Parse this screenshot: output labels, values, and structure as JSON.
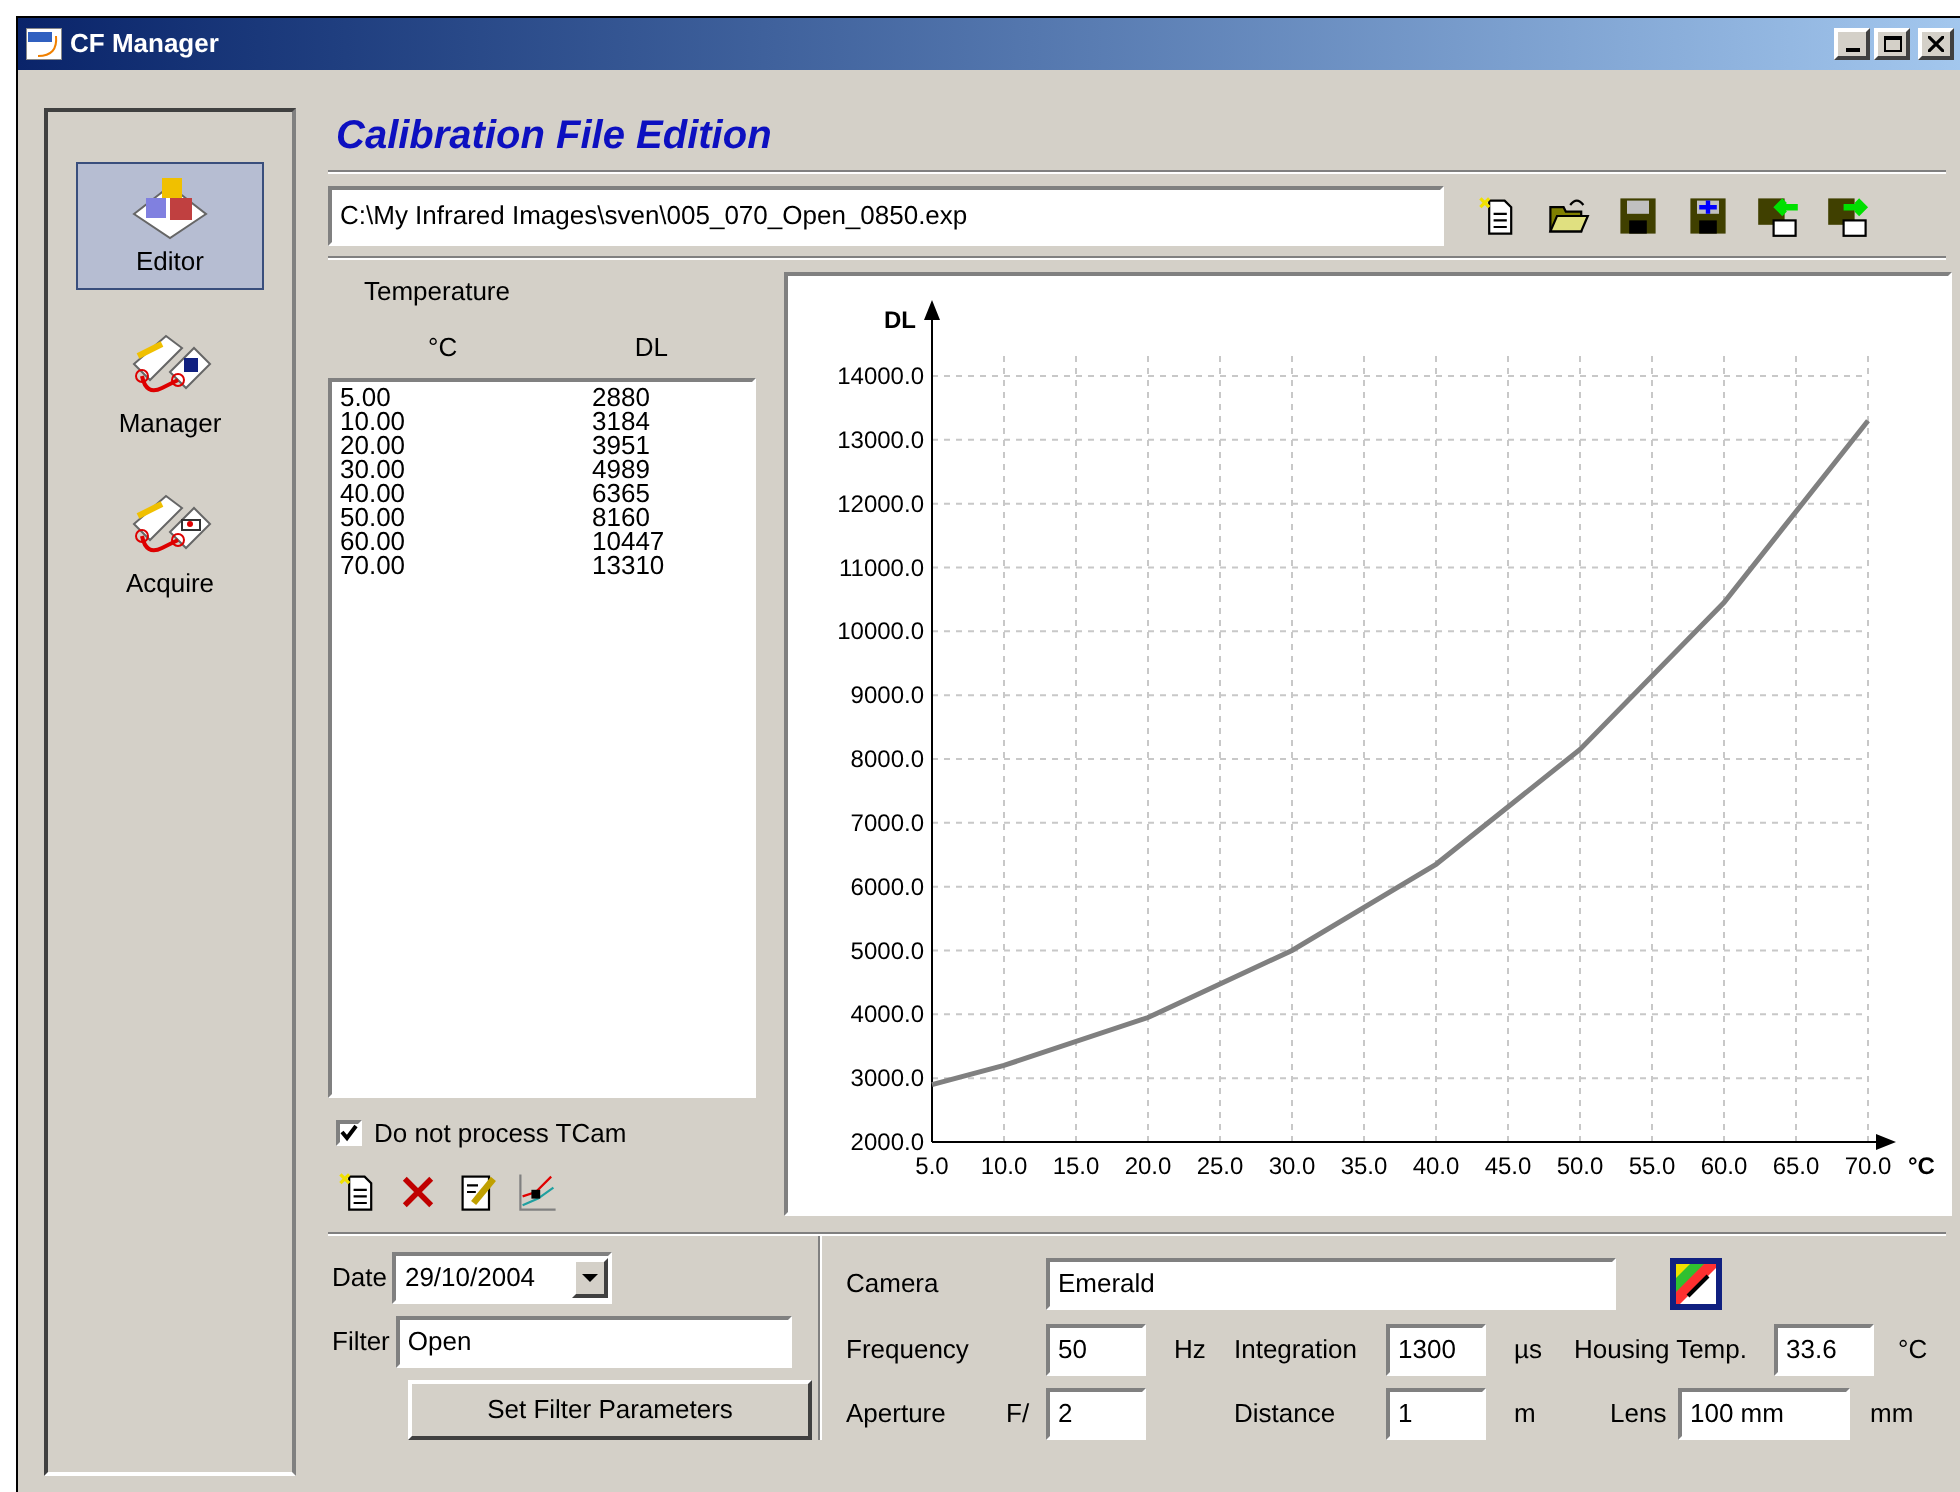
{
  "window": {
    "title": "CF Manager"
  },
  "sidebar": {
    "items": [
      {
        "label": "Editor",
        "kind": "cubes",
        "selected": true
      },
      {
        "label": "Manager",
        "kind": "chain",
        "selected": false
      },
      {
        "label": "Acquire",
        "kind": "camera-chain",
        "selected": false
      }
    ]
  },
  "heading": "Calibration File Edition",
  "file_path": "C:\\My Infrared Images\\sven\\005_070_Open_0850.exp",
  "toolbar": [
    {
      "kind": "new"
    },
    {
      "kind": "open"
    },
    {
      "kind": "save"
    },
    {
      "kind": "save-as"
    },
    {
      "kind": "import-txt"
    },
    {
      "kind": "export-txt"
    }
  ],
  "table": {
    "title": "Temperature",
    "columns": [
      "°C",
      "DL"
    ],
    "rows": [
      [
        "5.00",
        "2880"
      ],
      [
        "10.00",
        "3184"
      ],
      [
        "20.00",
        "3951"
      ],
      [
        "30.00",
        "4989"
      ],
      [
        "40.00",
        "6365"
      ],
      [
        "50.00",
        "8160"
      ],
      [
        "60.00",
        "10447"
      ],
      [
        "70.00",
        "13310"
      ]
    ]
  },
  "do_not_process": {
    "label": "Do not process TCam",
    "checked": true
  },
  "list_tools": [
    {
      "kind": "new"
    },
    {
      "kind": "delete"
    },
    {
      "kind": "edit"
    },
    {
      "kind": "graph"
    }
  ],
  "chart": {
    "chart_data": {
      "type": "line",
      "xlabel": "°C",
      "ylabel": "DL",
      "x": [
        5,
        10,
        20,
        30,
        40,
        50,
        60,
        70
      ],
      "series": [
        {
          "color": "#808080",
          "values": [
            2900,
            3200,
            3950,
            5000,
            6350,
            8150,
            10450,
            13300
          ]
        }
      ],
      "grid": true,
      "xlim": [
        5,
        70
      ],
      "ylim": [
        2000,
        14000
      ],
      "xticks": [
        {
          "value": 5,
          "label": "5.0"
        },
        {
          "value": 10,
          "label": "10.0"
        },
        {
          "value": 15,
          "label": "15.0"
        },
        {
          "value": 20,
          "label": "20.0"
        },
        {
          "value": 25,
          "label": "25.0"
        },
        {
          "value": 30,
          "label": "30.0"
        },
        {
          "value": 35,
          "label": "35.0"
        },
        {
          "value": 40,
          "label": "40.0"
        },
        {
          "value": 45,
          "label": "45.0"
        },
        {
          "value": 50,
          "label": "50.0"
        },
        {
          "value": 55,
          "label": "55.0"
        },
        {
          "value": 60,
          "label": "60.0"
        },
        {
          "value": 65,
          "label": "65.0"
        },
        {
          "value": 70,
          "label": "70.0"
        }
      ],
      "yticks": [
        {
          "value": 2000,
          "label": "2000.0"
        },
        {
          "value": 3000,
          "label": "3000.0"
        },
        {
          "value": 4000,
          "label": "4000.0"
        },
        {
          "value": 5000,
          "label": "5000.0"
        },
        {
          "value": 6000,
          "label": "6000.0"
        },
        {
          "value": 7000,
          "label": "7000.0"
        },
        {
          "value": 8000,
          "label": "8000.0"
        },
        {
          "value": 9000,
          "label": "9000.0"
        },
        {
          "value": 10000,
          "label": "10000.0"
        },
        {
          "value": 11000,
          "label": "11000.0"
        },
        {
          "value": 12000,
          "label": "12000.0"
        },
        {
          "value": 13000,
          "label": "13000.0"
        },
        {
          "value": 14000,
          "label": "14000.0"
        }
      ]
    }
  },
  "date": {
    "label": "Date",
    "value": "29/10/2004"
  },
  "filter": {
    "label": "Filter",
    "value": "Open"
  },
  "set_filter_button": "Set Filter Parameters",
  "camera": {
    "label": "Camera",
    "value": "Emerald"
  },
  "frequency": {
    "label": "Frequency",
    "value": "50",
    "unit": "Hz"
  },
  "integration": {
    "label": "Integration",
    "value": "1300",
    "unit": "µs"
  },
  "housing_temp": {
    "label": "Housing Temp.",
    "value": "33.6",
    "unit": "°C"
  },
  "aperture": {
    "label": "Aperture",
    "prefix": "F/",
    "value": "2"
  },
  "distance": {
    "label": "Distance",
    "value": "1",
    "unit": "m"
  },
  "lens": {
    "label": "Lens",
    "value": "100 mm",
    "unit": "mm"
  }
}
